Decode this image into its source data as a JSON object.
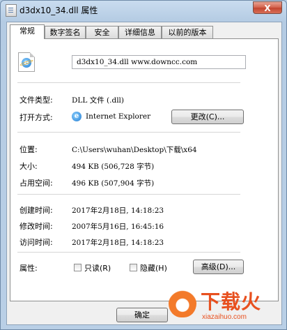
{
  "window": {
    "title": "d3dx10_34.dll 属性",
    "close_label": "X"
  },
  "tabs": [
    {
      "label": "常规"
    },
    {
      "label": "数字签名"
    },
    {
      "label": "安全"
    },
    {
      "label": "详细信息"
    },
    {
      "label": "以前的版本"
    }
  ],
  "general": {
    "file_name": "d3dx10_34.dll  www.downcc.com",
    "type_label": "文件类型:",
    "type_value": "DLL 文件 (.dll)",
    "opens_with_label": "打开方式:",
    "opens_with_value": "Internet Explorer",
    "change_button": "更改(C)...",
    "location_label": "位置:",
    "location_value": "C:\\Users\\wuhan\\Desktop\\下载\\x64",
    "size_label": "大小:",
    "size_value": "494 KB (506,728 字节)",
    "disk_size_label": "占用空间:",
    "disk_size_value": "496 KB (507,904 字节)",
    "created_label": "创建时间:",
    "created_value": "2017年2月18日, 14:18:23",
    "modified_label": "修改时间:",
    "modified_value": "2007年5月16日, 16:45:16",
    "accessed_label": "访问时间:",
    "accessed_value": "2017年2月18日, 14:18:23",
    "attributes_label": "属性:",
    "readonly_label": "只读(R)",
    "hidden_label": "隐藏(H)",
    "advanced_button": "高级(D)..."
  },
  "footer": {
    "ok_button": "确定"
  },
  "watermark": {
    "text": "下载火",
    "url": "xiazaihuo.com"
  },
  "colors": {
    "titlebar": "#c9dcef",
    "close": "#c2442f",
    "watermark": "#e8501f"
  }
}
